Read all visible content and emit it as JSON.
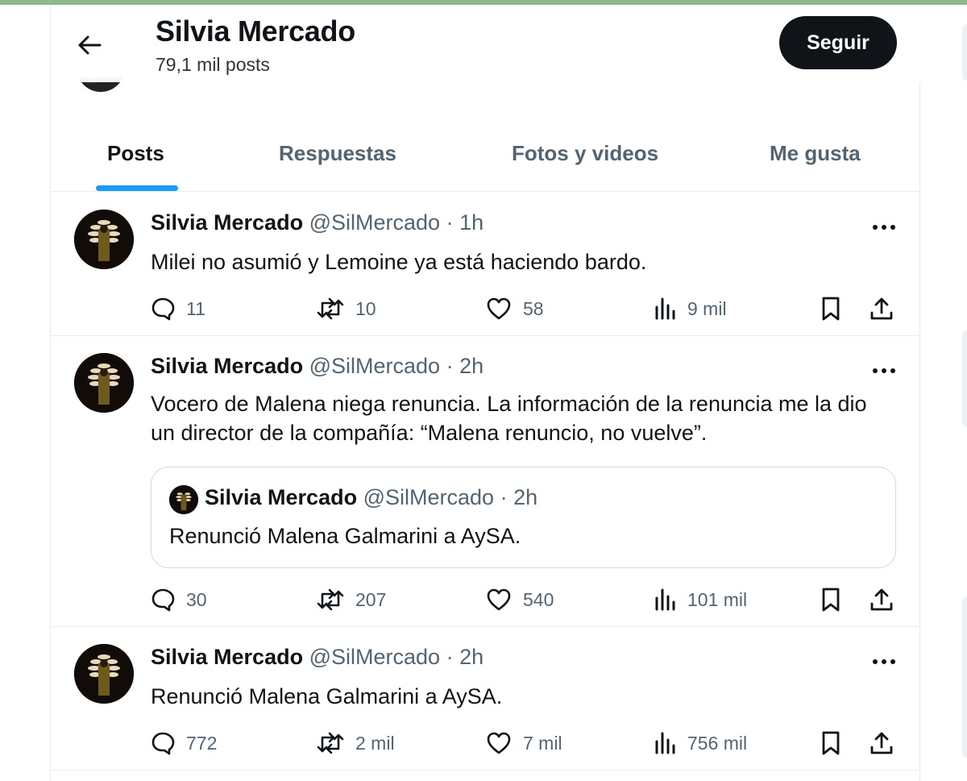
{
  "header": {
    "title": "Silvia Mercado",
    "post_count": "79,1 mil posts",
    "follow_label": "Seguir"
  },
  "tabs": [
    {
      "label": "Posts",
      "active": true
    },
    {
      "label": "Respuestas",
      "active": false
    },
    {
      "label": "Fotos y videos",
      "active": false
    },
    {
      "label": "Me gusta",
      "active": false
    }
  ],
  "posts": [
    {
      "name": "Silvia Mercado",
      "handle": "@SilMercado",
      "sep": "·",
      "time": "1h",
      "text": "Milei no asumió y Lemoine ya está haciendo bardo.",
      "replies": "11",
      "reposts": "10",
      "likes": "58",
      "views": "9 mil"
    },
    {
      "name": "Silvia Mercado",
      "handle": "@SilMercado",
      "sep": "·",
      "time": "2h",
      "text_line1": "Vocero de Malena niega renuncia. La información de la renuncia me la dio",
      "text_line2": "un director de la compañía: “Malena renuncio, no vuelve”.",
      "quote": {
        "name": "Silvia Mercado",
        "handle": "@SilMercado",
        "sep": "·",
        "time": "2h",
        "text": "Renunció Malena Galmarini a AySA."
      },
      "replies": "30",
      "reposts": "207",
      "likes": "540",
      "views": "101 mil"
    },
    {
      "name": "Silvia Mercado",
      "handle": "@SilMercado",
      "sep": "·",
      "time": "2h",
      "text": "Renunció Malena Galmarini a AySA.",
      "replies": "772",
      "reposts": "2 mil",
      "likes": "7 mil",
      "views": "756 mil"
    }
  ],
  "icons": {
    "back": "arrow-left-icon",
    "more": "more-horizontal-icon",
    "reply": "speech-bubble-icon",
    "repost": "repost-icon",
    "like": "heart-icon",
    "views": "bar-chart-icon",
    "bookmark": "bookmark-icon",
    "share": "share-upload-icon"
  },
  "colors": {
    "accent": "#1d9bf0",
    "text": "#0f1419",
    "secondary": "#536471",
    "follow_bg": "#0f1419"
  }
}
